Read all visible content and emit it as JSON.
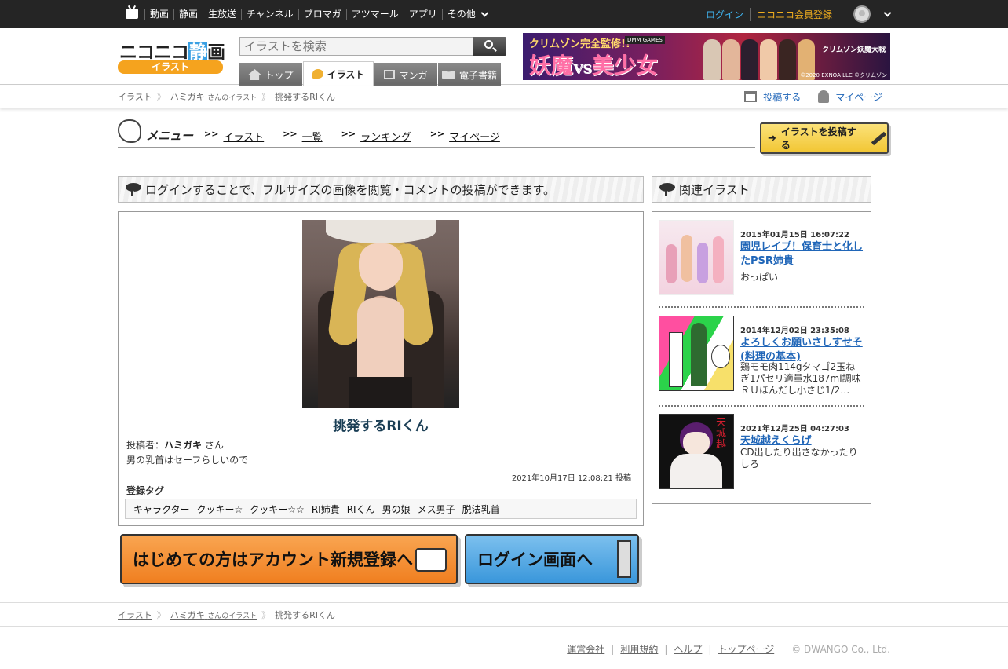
{
  "topbar": {
    "nav": [
      "動画",
      "静画",
      "生放送",
      "チャンネル",
      "ブロマガ",
      "アツマール",
      "アプリ",
      "その他"
    ],
    "login": "ログイン",
    "register": "ニコニコ会員登録"
  },
  "header": {
    "logo_main": "ニコニコ",
    "logo_mid": "静",
    "logo_end": "画",
    "logo_sub": "イラスト",
    "search_placeholder": "イラストを検索",
    "tabs": [
      {
        "label": "トップ",
        "active": false
      },
      {
        "label": "イラスト",
        "active": true
      },
      {
        "label": "マンガ",
        "active": false
      },
      {
        "label": "電子書籍",
        "active": false
      }
    ],
    "banner": {
      "line1": "クリムゾン完全監修!!",
      "brand": "DMM GAMES",
      "title_a": "妖魔",
      "title_vs": "VS",
      "title_b": "美少女",
      "right_text": "クリムゾン妖魔大戦",
      "copyright": "©2020 EXNOA LLC ©クリムゾン"
    }
  },
  "breadcrumb": {
    "items": [
      "イラスト",
      "ハミガキ",
      "さんのイラスト",
      "挑発するRIくん"
    ],
    "post_link": "投稿する",
    "mypage_link": "マイページ"
  },
  "menu": {
    "title": "メニュー",
    "prefix": ">>",
    "links": [
      "イラスト",
      "一覧",
      "ランキング",
      "マイページ"
    ],
    "post_button": "イラストを投稿する"
  },
  "main": {
    "heading": "ログインすることで、フルサイズの画像を閲覧・コメントの投稿ができます。",
    "illust_title": "挑発するRIくん",
    "poster_label": "投稿者：",
    "poster_name": "ハミガキ",
    "poster_suffix": "さん",
    "description": "男の乳首はセーフらしいので",
    "post_date": "2021年10月17日 12:08:21 投稿",
    "tags_label": "登録タグ",
    "tags": [
      "キャラクター",
      "クッキー☆",
      "クッキー☆☆",
      "RI姉貴",
      "RIくん",
      "男の娘",
      "メス男子",
      "脱法乳首"
    ]
  },
  "buttons": {
    "register": "はじめての方はアカウント新規登録へ",
    "login": "ログイン画面へ"
  },
  "related": {
    "heading": "関連イラスト",
    "items": [
      {
        "date": "2015年01月15日 16:07:22",
        "title": "園児レイプ！保育士と化したPSR姉貴",
        "text": "おっぱい"
      },
      {
        "date": "2014年12月02日 23:35:08",
        "title": "よろしくお願いさしすせそ(料理の基本)",
        "text": "鶏モモ肉114gタマゴ2玉ねぎ1パセリ適量水187ml調味ＲＵほんだし小さじ1/2…"
      },
      {
        "date": "2021年12月25日 04:27:03",
        "title": "天城越えくらげ",
        "text": "CD出したり出さなかったりしろ"
      }
    ]
  },
  "footer": {
    "crumbs": [
      "イラスト",
      "ハミガキ",
      "さんのイラスト",
      "挑発するRIくん"
    ],
    "links": [
      "運営会社",
      "利用規約",
      "ヘルプ",
      "トップページ"
    ],
    "copyright": "© DWANGO Co., Ltd."
  },
  "colors": {
    "topbar_bg": "#252525",
    "login_link": "#3fb3ef",
    "register_link": "#f0ad1e",
    "logo_orange": "#f5a31e",
    "link_blue": "#2066b8",
    "title_navy": "#1a3e55",
    "register_button": "#f08a2c",
    "login_button": "#4aa3e0"
  }
}
